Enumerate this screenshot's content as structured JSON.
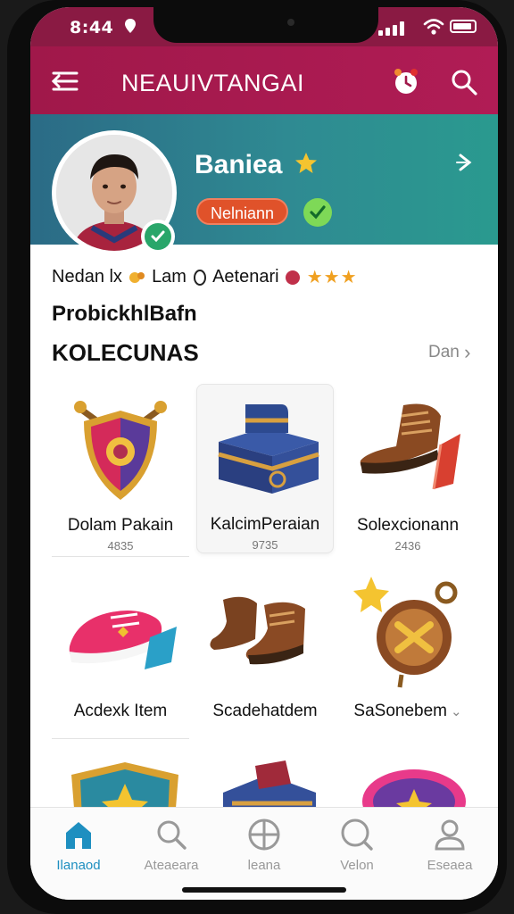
{
  "status_bar": {
    "time": "8:44"
  },
  "app_bar": {
    "title": "NEAUIVTANGAI",
    "icons": [
      "menu-icon",
      "alarm-icon",
      "search-icon"
    ]
  },
  "profile": {
    "name": "Baniea",
    "tag": "Nelniann"
  },
  "stats": {
    "text_a": "Nedan lx",
    "text_b": "Lam",
    "text_c": "Aetenari",
    "stars": "★★★"
  },
  "section": {
    "subtitle": "ProbickhlBafn",
    "title": "KOLECUNAS",
    "see_all": "Dan"
  },
  "items": [
    {
      "name": "Dolam Pakain",
      "count": "4835",
      "icon": "shield-emblem-icon"
    },
    {
      "name": "KalcimPeraian",
      "count": "9735",
      "icon": "treasure-chest-icon"
    },
    {
      "name": "Solexcionann",
      "count": "2436",
      "icon": "boot-icon"
    },
    {
      "name": "Acdexk Item",
      "count": "",
      "icon": "sneaker-icon"
    },
    {
      "name": "Scadehatdem",
      "count": "",
      "icon": "boots-pair-icon"
    },
    {
      "name": "SaSonebem",
      "count": "",
      "icon": "compass-medal-icon"
    }
  ],
  "bottom_nav": [
    {
      "label": "Ilanaod",
      "icon": "home-icon",
      "active": true
    },
    {
      "label": "Ateaeara",
      "icon": "search-icon",
      "active": false
    },
    {
      "label": "leana",
      "icon": "crosshair-icon",
      "active": false
    },
    {
      "label": "Velon",
      "icon": "search-icon",
      "active": false
    },
    {
      "label": "Eseaea",
      "icon": "user-icon",
      "active": false
    }
  ],
  "colors": {
    "app_bar": "#a0184a",
    "profile_bg": "#2f8a92",
    "tag": "#e0522a",
    "active_nav": "#1e8fc0"
  }
}
